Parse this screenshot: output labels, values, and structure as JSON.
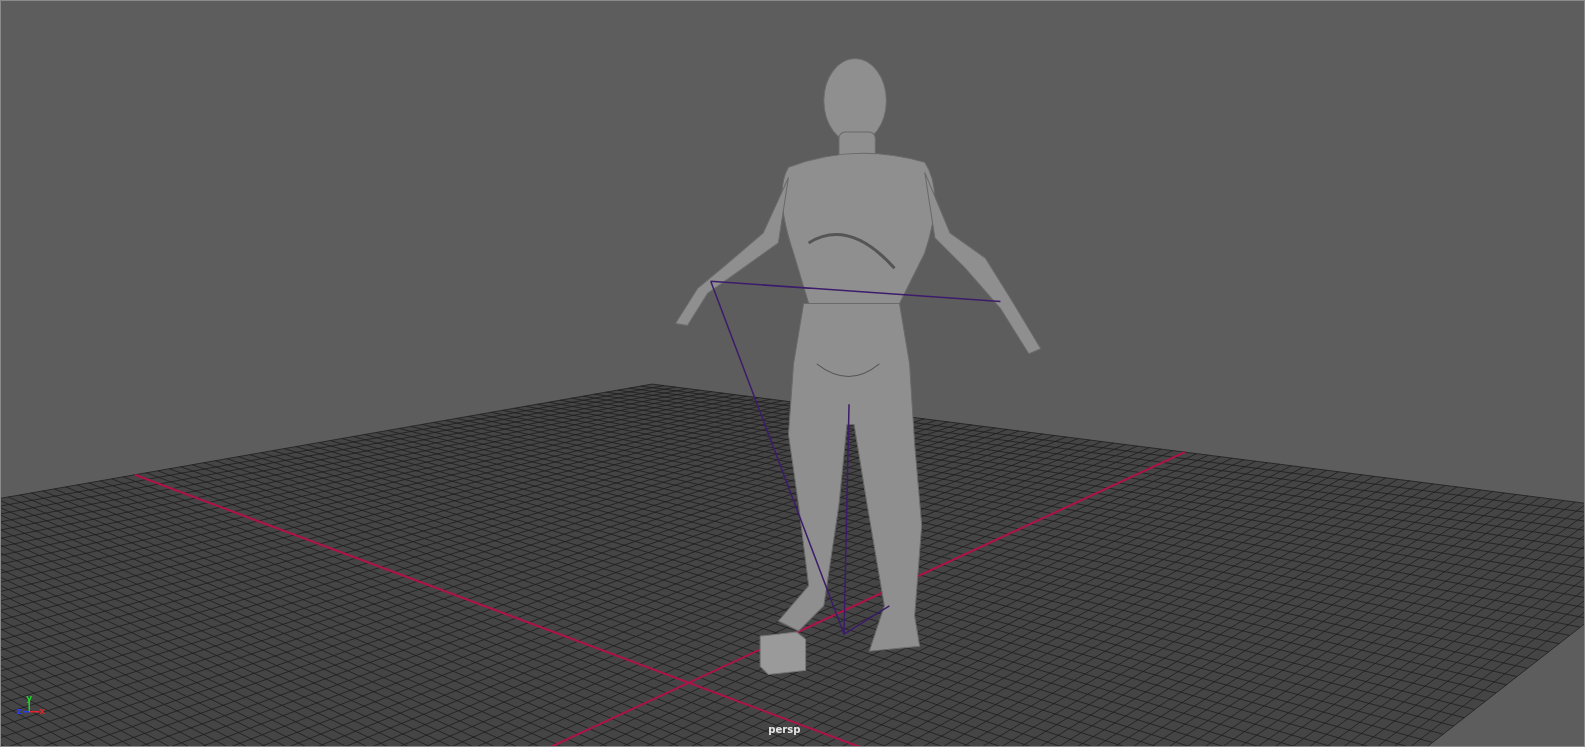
{
  "viewport": {
    "camera_label": "persp",
    "axis_gizmo": [
      {
        "text": "x",
        "color": "#e8232a"
      },
      {
        "text": "y",
        "color": "#1fd12a"
      },
      {
        "text": "z",
        "color": "#2a3cf0"
      }
    ]
  }
}
